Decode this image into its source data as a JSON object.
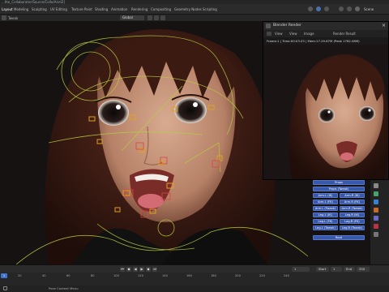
{
  "window": {
    "title": "...the_Collaborator/Source/Colle/Ariel2]"
  },
  "topbar": {
    "tabs": [
      "Layout",
      "Modeling",
      "Sculpting",
      "UV Editing",
      "Texture Paint",
      "Shading",
      "Animation",
      "Rendering",
      "Compositing",
      "Geometry Nodes",
      "Scripting"
    ],
    "active_tab": "Layout",
    "scene_label": "Scene"
  },
  "viewport_header": {
    "mode_label": "Tweak",
    "orientation_label": "Global"
  },
  "render_window": {
    "title": "Blender Render",
    "menu": [
      "View",
      "View",
      "Image"
    ],
    "result_label": "Render Result",
    "info": "Frame:1 | Time:00:03.03 | Mem:17.29.67M (Peak 1762.08M)"
  },
  "picker": {
    "buttons": [
      {
        "label": "Props"
      },
      {
        "label": "Props (Tweak)"
      },
      {
        "label": "Arm.L (IK)"
      },
      {
        "label": "Arm.R (IK)"
      },
      {
        "label": "Arm.L (FK)"
      },
      {
        "label": "Arm.R (FK)"
      },
      {
        "label": "Arm.L (Tweak)"
      },
      {
        "label": "Arm.R (Tweak)"
      },
      {
        "label": "Leg.L (IK)"
      },
      {
        "label": "Leg.R (IK)"
      },
      {
        "label": "Leg.L (FK)"
      },
      {
        "label": "Leg.R (FK)"
      },
      {
        "label": "Leg.L (Tweak)"
      },
      {
        "label": "Leg.R (Tweak)"
      },
      {
        "label": "Root"
      }
    ],
    "color": "#3a58a8"
  },
  "timeline": {
    "current_frame": "1",
    "start_label": "Start",
    "start_value": "1",
    "end_label": "End",
    "end_value": "250",
    "ticks": [
      "20",
      "40",
      "60",
      "80",
      "100",
      "120",
      "140",
      "160",
      "180",
      "200",
      "220",
      "240"
    ]
  },
  "statusbar": {
    "hint": "Pose Context Menu"
  },
  "colors": {
    "accent": "#3f74d1",
    "wire": "#b8cc40",
    "control": "#e0a020"
  }
}
